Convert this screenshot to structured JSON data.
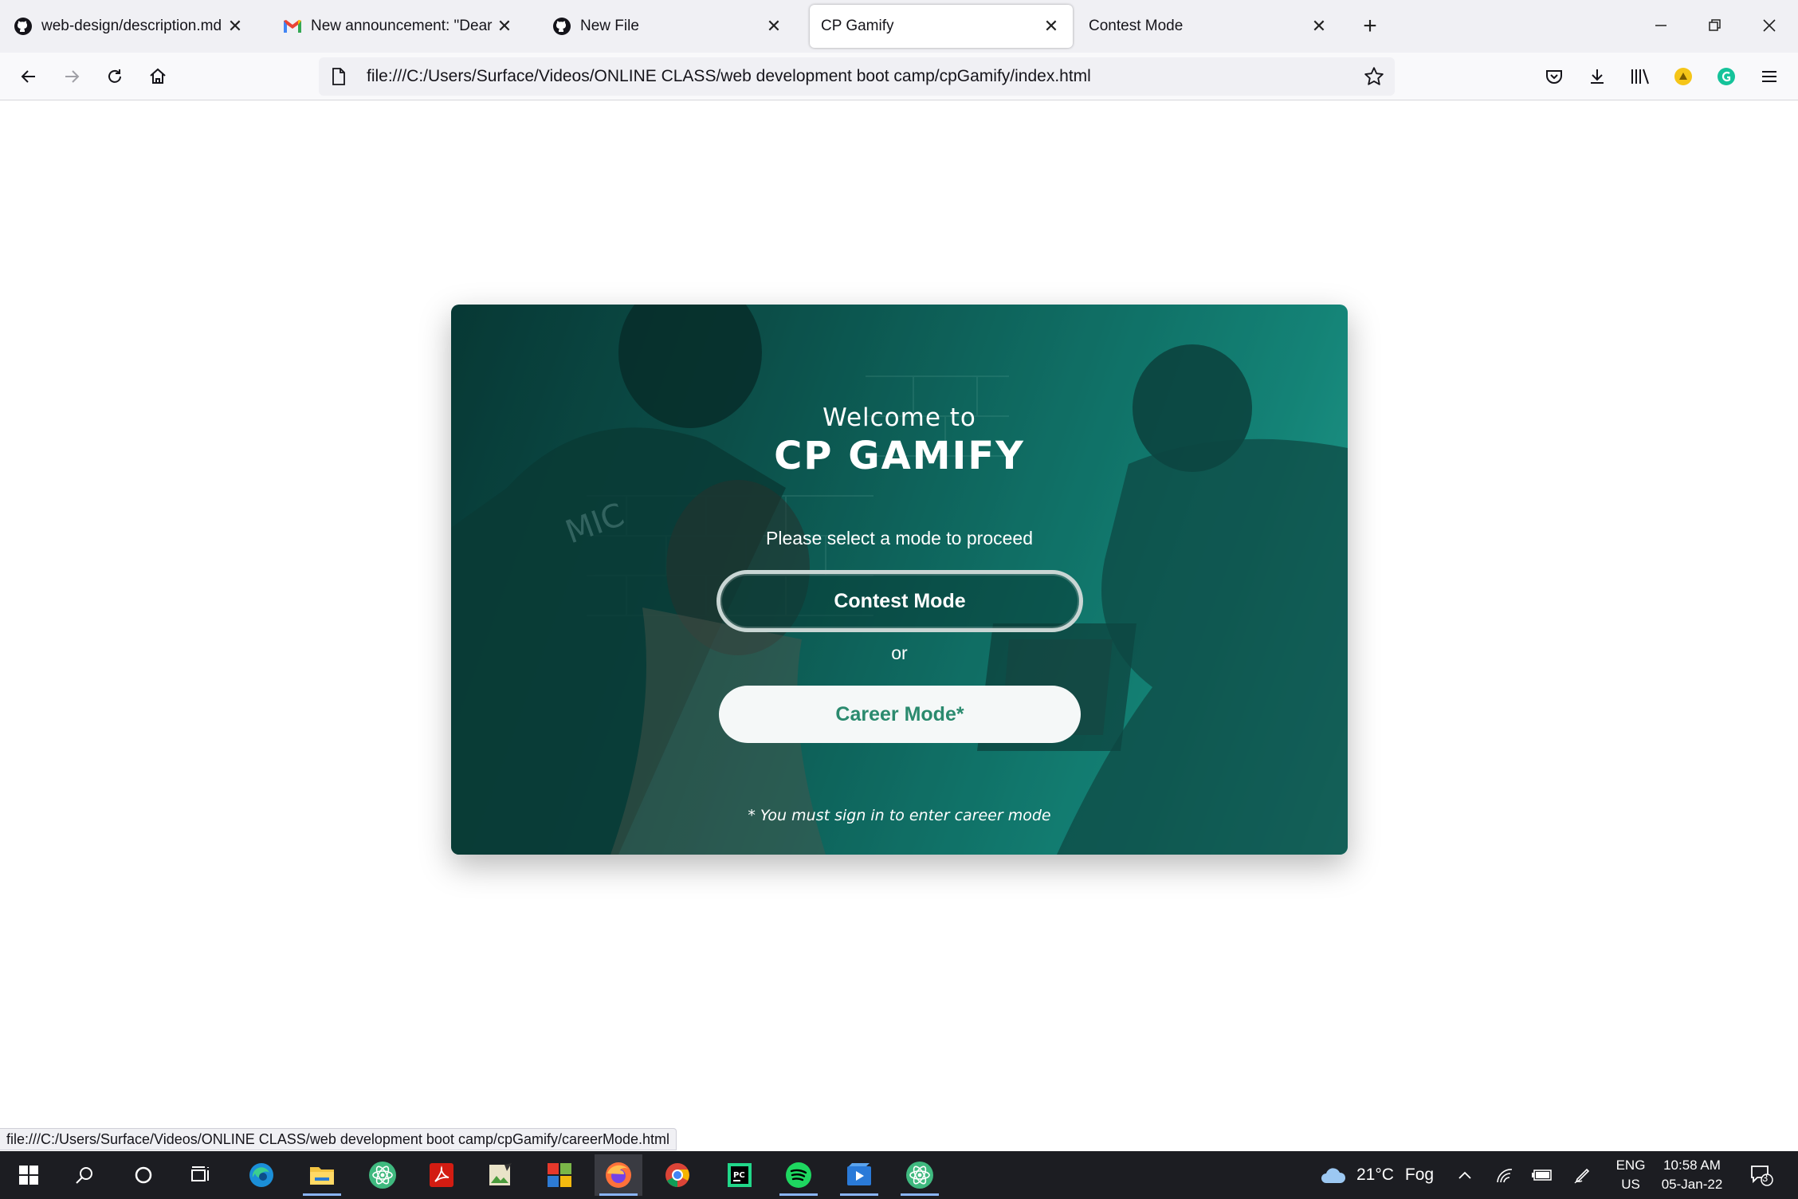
{
  "browser": {
    "tabs": [
      {
        "title": "web-design/description.md at m",
        "favicon": "github-icon",
        "active": false
      },
      {
        "title": "New announcement: \"Dear Stud",
        "favicon": "gmail-icon",
        "active": false
      },
      {
        "title": "New File",
        "favicon": "github-icon",
        "active": false
      },
      {
        "title": "CP Gamify",
        "favicon": "none",
        "active": true
      },
      {
        "title": "Contest Mode",
        "favicon": "none",
        "active": false
      }
    ],
    "url": "file:///C:/Users/Surface/Videos/ONLINE CLASS/web development boot camp/cpGamify/index.html",
    "status_url": "file:///C:/Users/Surface/Videos/ONLINE CLASS/web development boot camp/cpGamify/careerMode.html"
  },
  "page": {
    "welcome": "Welcome to",
    "brand": "CP GAMIFY",
    "prompt": "Please select a mode to proceed",
    "contest_button": "Contest Mode",
    "or": "or",
    "career_button": "Career Mode*",
    "note": "* You must sign in to enter career mode"
  },
  "taskbar": {
    "weather_temp": "21°C",
    "weather_desc": "Fog",
    "lang_top": "ENG",
    "lang_bottom": "US",
    "time": "10:58 AM",
    "date": "05-Jan-22",
    "notification_count": "3"
  },
  "colors": {
    "card_gradient_start": "#062e2b",
    "card_gradient_end": "#29aa99",
    "career_text": "#2a8a6e"
  }
}
